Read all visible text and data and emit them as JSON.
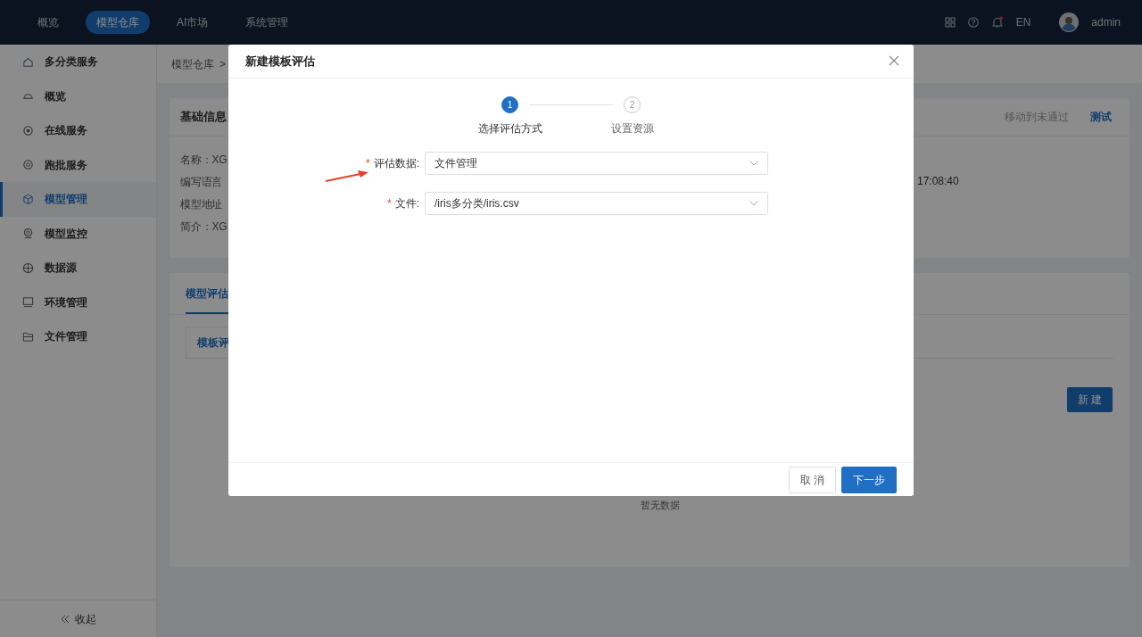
{
  "top_nav": {
    "items": [
      {
        "label": "概览",
        "selected": false
      },
      {
        "label": "模型仓库",
        "selected": true
      },
      {
        "label": "AI市场",
        "selected": false
      },
      {
        "label": "系统管理",
        "selected": false
      }
    ],
    "language": "EN",
    "notification_unread": true,
    "user": "admin"
  },
  "sidebar": {
    "items": [
      {
        "label": "多分类服务",
        "selected": false
      },
      {
        "label": "概览",
        "selected": false
      },
      {
        "label": "在线服务",
        "selected": false
      },
      {
        "label": "跑批服务",
        "selected": false
      },
      {
        "label": "模型管理",
        "selected": true
      },
      {
        "label": "模型监控",
        "selected": false
      },
      {
        "label": "数据源",
        "selected": false
      },
      {
        "label": "环境管理",
        "selected": false
      },
      {
        "label": "文件管理",
        "selected": false
      }
    ],
    "collapse_label": "收起"
  },
  "breadcrumb": {
    "items": [
      "模型仓库"
    ],
    "separator": ">"
  },
  "basic_info": {
    "title": "基础信息",
    "actions": [
      {
        "label": "移动到未通过",
        "kind": "muted"
      },
      {
        "label": "测试",
        "kind": "link"
      }
    ],
    "fields": [
      "名称：XG",
      "编写语言",
      "模型地址",
      "简介：XG"
    ],
    "time_fragment": "17:08:40"
  },
  "evaluation": {
    "tabs": [
      {
        "label": "模型评估",
        "selected": true
      }
    ],
    "sub_tabs": [
      {
        "label": "模板评",
        "selected": true
      }
    ],
    "new_button": "新 建",
    "empty_text": "暂无数据"
  },
  "dialog": {
    "title": "新建模板评估",
    "steps": [
      {
        "number": "1",
        "label": "选择评估方式",
        "selected": true
      },
      {
        "number": "2",
        "label": "设置资源",
        "selected": false
      }
    ],
    "fields": [
      {
        "required_mark": "*",
        "label": "评估数据:",
        "value": "文件管理"
      },
      {
        "required_mark": "*",
        "label": "文件:",
        "value": "/iris多分类/iris.csv"
      }
    ],
    "buttons": [
      {
        "label": "取 消",
        "kind": "secondary"
      },
      {
        "label": "下一步",
        "kind": "primary"
      }
    ]
  }
}
